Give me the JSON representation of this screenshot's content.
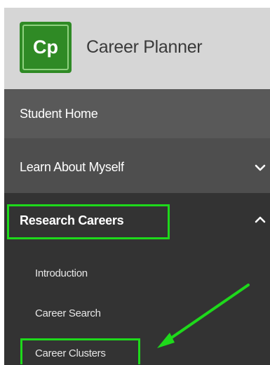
{
  "header": {
    "logo_text": "Cp",
    "app_title": "Career Planner"
  },
  "nav": {
    "student_home": "Student Home",
    "learn_about_myself": "Learn About Myself",
    "research_careers": {
      "label": "Research Careers",
      "expanded": true,
      "items": [
        {
          "label": "Introduction"
        },
        {
          "label": "Career Search"
        },
        {
          "label": "Career Clusters"
        }
      ]
    }
  },
  "annotations": {
    "highlight_color": "#1ed91b",
    "highlighted_items": [
      "Research Careers",
      "Career Clusters"
    ],
    "arrow_target": "Career Clusters"
  },
  "colors": {
    "header_bg": "#d6d6d6",
    "logo_green": "#2f8a25",
    "nav_home_bg": "#595959",
    "nav_learn_bg": "#4e4e4e",
    "nav_research_bg": "#333333"
  }
}
